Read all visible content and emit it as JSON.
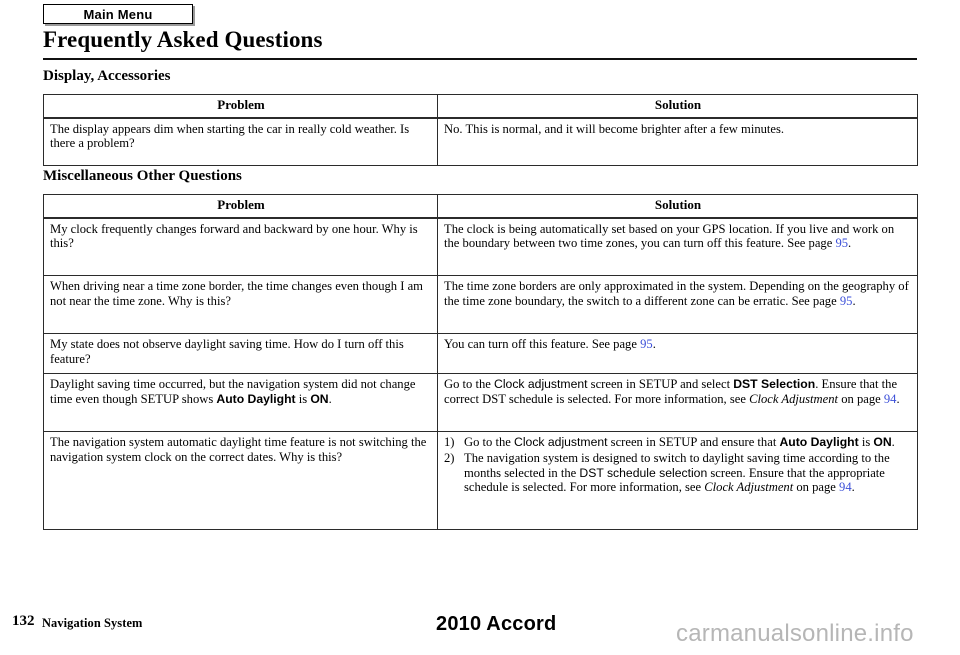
{
  "header": {
    "main_menu_label": "Main Menu",
    "title": "Frequently Asked Questions"
  },
  "sections": [
    {
      "heading": "Display, Accessories",
      "columns": {
        "problem": "Problem",
        "solution": "Solution"
      },
      "rows": [
        {
          "problem": "The display appears dim when starting the car in really cold weather. Is there a problem?",
          "solution": "No. This is normal, and it will become brighter after a few minutes."
        }
      ]
    },
    {
      "heading": "Miscellaneous Other Questions",
      "columns": {
        "problem": "Problem",
        "solution": "Solution"
      },
      "rows": [
        {
          "problem": "My clock frequently changes forward and backward by one hour. Why is this?",
          "solution_runs": [
            {
              "text": "The clock is being automatically set based on your GPS location. If you live and work on the boundary between two time zones, you can turn off this feature. See page ",
              "style": "normal"
            },
            {
              "text": "95",
              "style": "pageref"
            },
            {
              "text": ".",
              "style": "normal"
            }
          ]
        },
        {
          "problem": "When driving near a time zone border, the time changes even though I am not near the time zone. Why is this?",
          "solution_runs": [
            {
              "text": "The time zone borders are only approximated in the system. Depending on the geography of the time zone boundary, the switch to a different zone can be erratic. See page ",
              "style": "normal"
            },
            {
              "text": "95",
              "style": "pageref"
            },
            {
              "text": ".",
              "style": "normal"
            }
          ]
        },
        {
          "problem": "My state does not observe daylight saving time. How do I turn off this feature?",
          "solution_runs": [
            {
              "text": "You can turn off this feature. See page ",
              "style": "normal"
            },
            {
              "text": "95",
              "style": "pageref"
            },
            {
              "text": ".",
              "style": "normal"
            }
          ]
        },
        {
          "problem_runs": [
            {
              "text": "Daylight saving time occurred, but the navigation system did not change time even though SETUP shows ",
              "style": "normal"
            },
            {
              "text": "Auto Daylight",
              "style": "sans-bold"
            },
            {
              "text": " is ",
              "style": "normal"
            },
            {
              "text": "ON",
              "style": "sans-bold"
            },
            {
              "text": ".",
              "style": "normal"
            }
          ],
          "solution_runs": [
            {
              "text": "Go to the ",
              "style": "normal"
            },
            {
              "text": "Clock adjustment",
              "style": "sans"
            },
            {
              "text": " screen in SETUP and select ",
              "style": "normal"
            },
            {
              "text": "DST Selection",
              "style": "sans-bold"
            },
            {
              "text": ". Ensure that the correct DST schedule is selected. For more information, see ",
              "style": "normal"
            },
            {
              "text": "Clock Adjustment",
              "style": "italic"
            },
            {
              "text": " on page ",
              "style": "normal"
            },
            {
              "text": "94",
              "style": "pageref"
            },
            {
              "text": ".",
              "style": "normal"
            }
          ]
        },
        {
          "problem": "The navigation system automatic daylight time feature is not switching the navigation system clock on the correct dates. Why is this?",
          "solution_list": [
            {
              "marker": "1)",
              "runs": [
                {
                  "text": "Go to the ",
                  "style": "normal"
                },
                {
                  "text": "Clock adjustment",
                  "style": "sans"
                },
                {
                  "text": " screen in SETUP and ensure that ",
                  "style": "normal"
                },
                {
                  "text": "Auto Daylight",
                  "style": "sans-bold"
                },
                {
                  "text": " is ",
                  "style": "normal"
                },
                {
                  "text": "ON",
                  "style": "sans-bold"
                },
                {
                  "text": ".",
                  "style": "normal"
                }
              ]
            },
            {
              "marker": "2)",
              "runs": [
                {
                  "text": "The navigation system is designed to switch to daylight saving time according to the months selected in the ",
                  "style": "normal"
                },
                {
                  "text": "DST schedule selection",
                  "style": "sans"
                },
                {
                  "text": " screen. Ensure that the appropriate schedule is selected. For more information, see ",
                  "style": "normal"
                },
                {
                  "text": "Clock Adjustment",
                  "style": "italic"
                },
                {
                  "text": " on page ",
                  "style": "normal"
                },
                {
                  "text": "94",
                  "style": "pageref"
                },
                {
                  "text": ".",
                  "style": "normal"
                }
              ]
            }
          ]
        }
      ]
    }
  ],
  "footer": {
    "page_number": "132",
    "section_name": "Navigation System",
    "model": "2010 Accord",
    "watermark": "carmanualsonline.info"
  },
  "colors": {
    "page_reference": "#3b4fd8",
    "watermark": "#b6b6b6",
    "rule": "#111111",
    "table_border": "#2b2b2b"
  }
}
